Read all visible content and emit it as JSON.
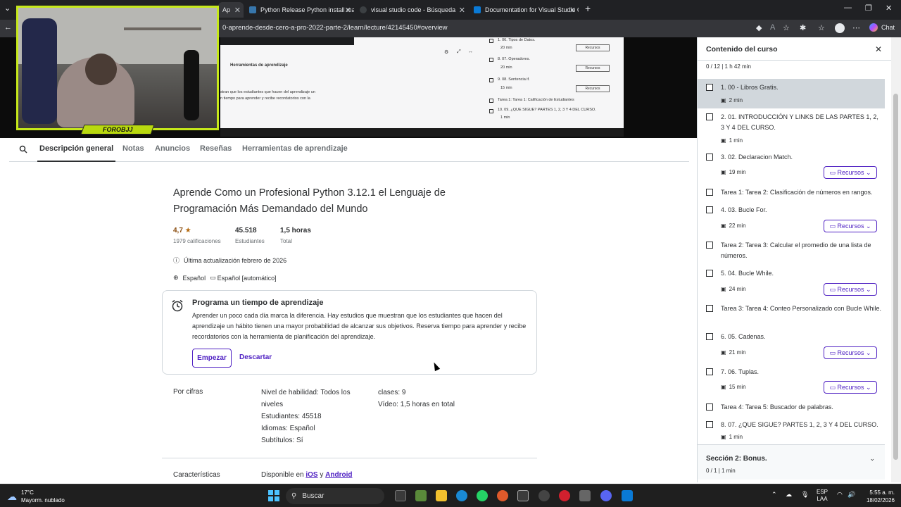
{
  "browser": {
    "tabs": [
      {
        "title": "Ap",
        "active": true
      },
      {
        "title": "Python Release Python install man"
      },
      {
        "title": "visual studio code - Búsqueda"
      },
      {
        "title": "Documentation for Visual Studio C"
      }
    ],
    "url": "0-aprende-desde-cero-a-pro-2022-parte-2/learn/lecture/42145450#overview",
    "chat_label": "Chat"
  },
  "stream": {
    "name_tag": "FOROBJJ"
  },
  "lecture_preview": {
    "heading": "Herramientas de aprendizaje",
    "text_1": "stran que los estudiantes que hacen del aprendizaje un",
    "text_2": "n tiempo para aprender y recibe recordatorios con la",
    "rows": [
      {
        "label": "1. 06. Tipos de Datos.",
        "dur": "20 min"
      },
      {
        "label": "8. 07. Operadores.",
        "dur": "20 min"
      },
      {
        "label": "9. 08. Sentencia if.",
        "dur": "15 min"
      },
      {
        "label": "Tarea 1: Tarea 1: Calificación de Estudiantes",
        "dur": ""
      },
      {
        "label": "10. 09. ¿QUE SIGUE? PARTES 1, 2, 3 Y 4 DEL CURSO.",
        "dur": "1 min"
      }
    ],
    "recursos_label": "Recursos"
  },
  "course_tabs": [
    "Descripción general",
    "Notas",
    "Anuncios",
    "Reseñas",
    "Herramientas de aprendizaje"
  ],
  "course": {
    "title": "Aprende Como un Profesional Python 3.12.1 el Lenguaje de Programación Más Demandado del Mundo",
    "rating": "4,7",
    "rating_count": "1979 calificaciones",
    "students": "45.518",
    "students_label": "Estudiantes",
    "total": "1,5 horas",
    "total_label": "Total",
    "updated": "Última actualización febrero de 2026",
    "language": "Español",
    "captions": "Español [automático]"
  },
  "schedule_card": {
    "title": "Programa un tiempo de aprendizaje",
    "text": "Aprender un poco cada día marca la diferencia. Hay estudios que muestran que los estudiantes que hacen del aprendizaje un hábito tienen una mayor probabilidad de alcanzar sus objetivos. Reserva tiempo para aprender y recibe recordatorios con la herramienta de planificación del aprendizaje.",
    "start_label": "Empezar",
    "dismiss_label": "Descartar"
  },
  "figures": {
    "label": "Por cifras",
    "col1": [
      "Nivel de habilidad: Todos los niveles",
      "Estudiantes: 45518",
      "Idiomas: Español",
      "Subtítulos: Sí"
    ],
    "col2": [
      "clases: 9",
      "Vídeo: 1,5 horas en total"
    ]
  },
  "features": {
    "label": "Características",
    "available_prefix": "Disponible en ",
    "ios": "iOS",
    "and": " y ",
    "android": "Android"
  },
  "sidebar": {
    "title": "Contenido del curso",
    "progress": "0 / 12 | 1 h 42 min",
    "lessons": [
      {
        "title": "1. 00 - Libros Gratis.",
        "dur": "2 min",
        "current": true
      },
      {
        "title": "2. 01. INTRODUCCIÓN Y LINKS DE LAS PARTES 1, 2, 3 Y 4 DEL CURSO.",
        "dur": "1 min"
      },
      {
        "title": "3. 02. Declaracion Match.",
        "dur": "19 min",
        "resources": "Recursos"
      },
      {
        "title": "Tarea 1: Tarea 2: Clasificación de números en rangos.",
        "dur": ""
      },
      {
        "title": "4. 03. Bucle For.",
        "dur": "22 min",
        "resources": "Recursos"
      },
      {
        "title": "Tarea 2: Tarea 3: Calcular el promedio de una lista de números.",
        "dur": ""
      },
      {
        "title": "5. 04. Bucle While.",
        "dur": "24 min",
        "resources": "Recursos"
      },
      {
        "title": "Tarea 3: Tarea 4: Conteo Personalizado con Bucle While.",
        "dur": ""
      },
      {
        "title": "6. 05. Cadenas.",
        "dur": "21 min",
        "resources": "Recursos"
      },
      {
        "title": "7. 06. Tuplas.",
        "dur": "15 min",
        "resources": "Recursos"
      },
      {
        "title": "Tarea 4: Tarea 5: Buscador de palabras.",
        "dur": ""
      },
      {
        "title": "8. 07. ¿QUE SIGUE? PARTES 1, 2, 3 Y 4 DEL CURSO.",
        "dur": "1 min"
      }
    ],
    "section2_title": "Sección 2: Bonus.",
    "section2_progress": "0 / 1 | 1 min"
  },
  "taskbar": {
    "temp": "17°C",
    "weather": "Mayorm. nublado",
    "search": "Buscar",
    "lang1": "ESP",
    "lang2": "LAA",
    "time": "5:55 a. m.",
    "date": "18/02/2026"
  }
}
